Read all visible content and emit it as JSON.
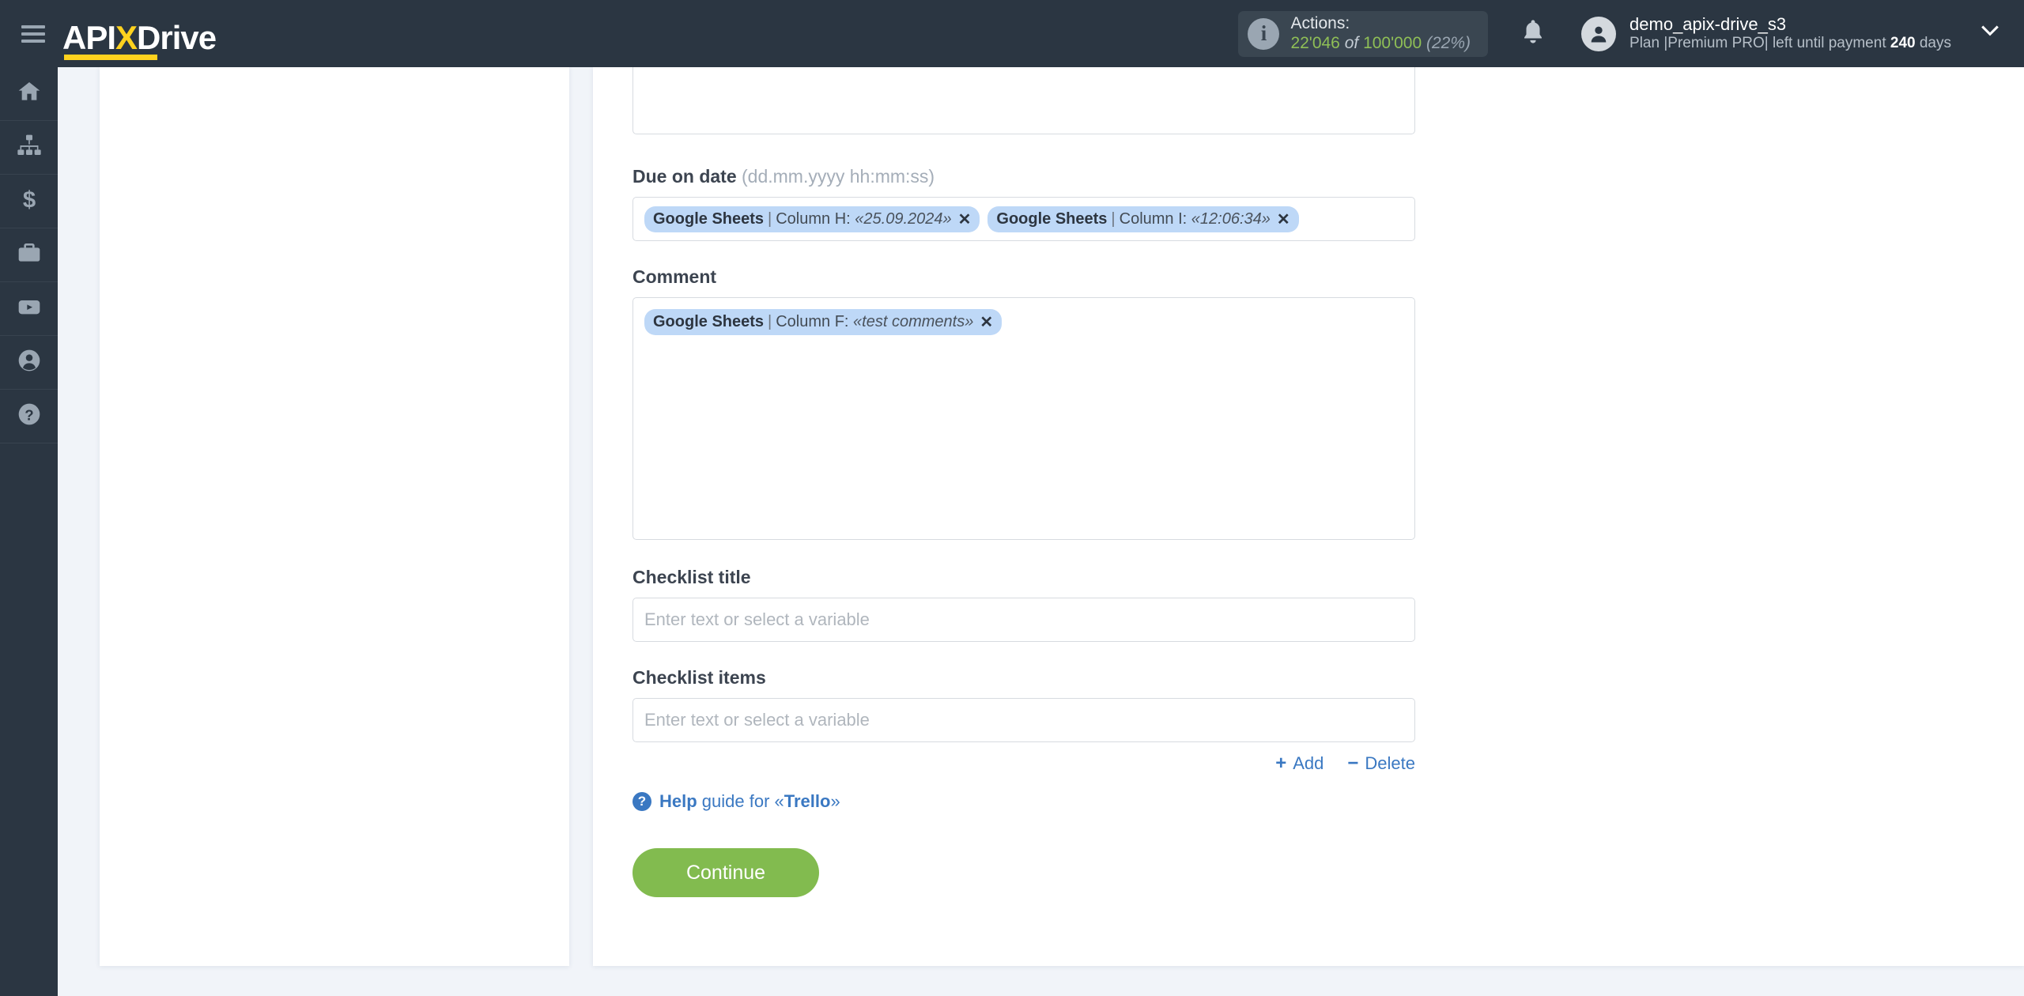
{
  "header": {
    "menu_icon": "hamburger-icon",
    "logo": {
      "part1": "API",
      "part2": "X",
      "part3": "Drive"
    },
    "actions": {
      "label": "Actions:",
      "used": "22'046",
      "of": "of",
      "total": "100'000",
      "percent": "(22%)",
      "info_icon": "info-icon"
    },
    "bell_icon": "bell-icon",
    "user": {
      "avatar_icon": "user-avatar-icon",
      "name": "demo_apix-drive_s3",
      "plan_prefix": "Plan |",
      "plan_name": "Premium PRO",
      "plan_mid": "| left until payment ",
      "days": "240",
      "days_suffix": " days"
    },
    "caret_icon": "chevron-down-icon"
  },
  "sidebar": {
    "items": [
      {
        "name": "home",
        "icon": "home-icon"
      },
      {
        "name": "connections",
        "icon": "sitemap-icon"
      },
      {
        "name": "billing",
        "icon": "dollar-icon"
      },
      {
        "name": "services",
        "icon": "briefcase-icon"
      },
      {
        "name": "video",
        "icon": "youtube-icon"
      },
      {
        "name": "account",
        "icon": "user-circle-icon"
      },
      {
        "name": "help",
        "icon": "question-circle-icon"
      }
    ]
  },
  "form": {
    "due_on_date": {
      "label": "Due on date",
      "hint": "(dd.mm.yyyy hh:mm:ss)",
      "chips": [
        {
          "source": "Google Sheets",
          "sep": "|",
          "field": "Column H:",
          "value": "«25.09.2024»",
          "remove": "✕"
        },
        {
          "source": "Google Sheets",
          "sep": "|",
          "field": "Column I:",
          "value": "«12:06:34»",
          "remove": "✕"
        }
      ]
    },
    "comment": {
      "label": "Comment",
      "chips": [
        {
          "source": "Google Sheets",
          "sep": "|",
          "field": "Column F:",
          "value": "«test comments»",
          "remove": "✕"
        }
      ]
    },
    "checklist_title": {
      "label": "Checklist title",
      "placeholder": "Enter text or select a variable",
      "value": ""
    },
    "checklist_items": {
      "label": "Checklist items",
      "placeholder": "Enter text or select a variable",
      "value": ""
    },
    "add_label": "Add",
    "add_icon": "plus-icon",
    "delete_label": "Delete",
    "delete_icon": "minus-icon",
    "help": {
      "icon": "question-mark-icon",
      "bold": "Help",
      "rest": " guide for «",
      "service": "Trello",
      "tail": "»"
    },
    "continue_label": "Continue"
  },
  "colors": {
    "header_bg": "#2b3642",
    "accent_yellow": "#ffd21e",
    "chip_bg": "#bed8f7",
    "link_blue": "#3a78c2",
    "continue_green": "#82bb4f",
    "actions_green": "#8fbf56",
    "page_bg": "#f1f4f9"
  }
}
